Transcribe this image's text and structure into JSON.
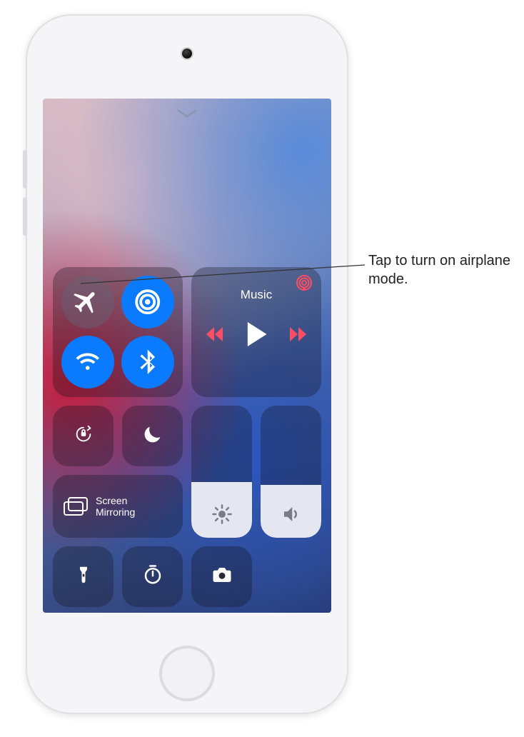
{
  "callout": {
    "text": "Tap to turn on airplane mode."
  },
  "connectivity": {
    "airplane": {
      "name": "airplane-mode",
      "active": false
    },
    "airdrop": {
      "name": "airdrop",
      "active": true
    },
    "wifi": {
      "name": "wifi",
      "active": true
    },
    "bluetooth": {
      "name": "bluetooth",
      "active": true
    }
  },
  "media": {
    "title": "Music",
    "airplay_indicator": "airplay-audio",
    "controls": {
      "back": "skip-back",
      "play": "play",
      "forward": "skip-forward"
    },
    "playing": false
  },
  "toggles": {
    "orientation_lock": {
      "name": "orientation-lock",
      "active": false
    },
    "do_not_disturb": {
      "name": "do-not-disturb",
      "active": false
    }
  },
  "screen_mirroring": {
    "label": "Screen Mirroring"
  },
  "sliders": {
    "brightness": {
      "name": "brightness",
      "level_percent": 42
    },
    "volume": {
      "name": "volume",
      "level_percent": 40
    }
  },
  "shortcuts": {
    "flashlight": {
      "name": "flashlight"
    },
    "timer": {
      "name": "timer"
    },
    "camera": {
      "name": "camera"
    }
  },
  "chevron": {
    "name": "dismiss-chevron"
  }
}
